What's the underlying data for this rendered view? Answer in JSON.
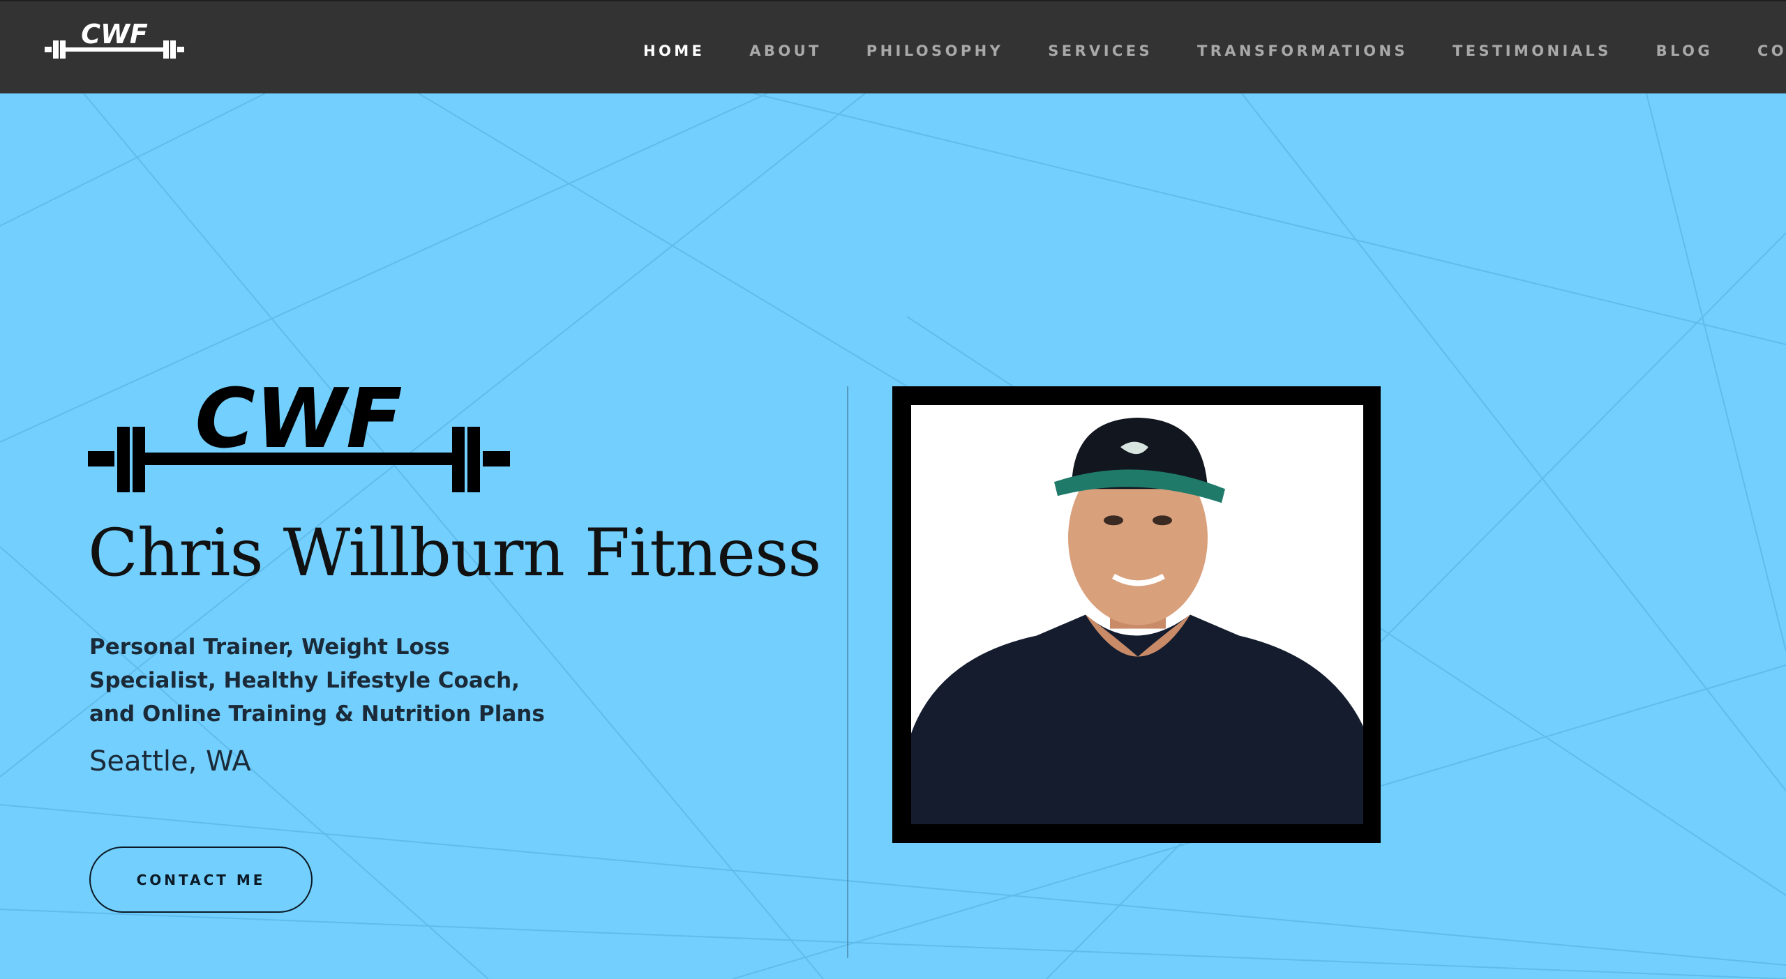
{
  "brand": {
    "logo_text": "CWF",
    "colors": {
      "nav_background": "#333333",
      "hero_background": "#73cffd",
      "nav_active": "#ffffff",
      "nav_inactive": "#a9a9a9"
    }
  },
  "nav": {
    "items": [
      {
        "label": "HOME",
        "active": true
      },
      {
        "label": "ABOUT",
        "active": false
      },
      {
        "label": "PHILOSOPHY",
        "active": false
      },
      {
        "label": "SERVICES",
        "active": false
      },
      {
        "label": "TRANSFORMATIONS",
        "active": false
      },
      {
        "label": "TESTIMONIALS",
        "active": false
      },
      {
        "label": "BLOG",
        "active": false
      },
      {
        "label": "CONTACT",
        "active": false
      }
    ]
  },
  "hero": {
    "logo_text": "CWF",
    "title": "Chris Willburn Fitness",
    "tagline": "Personal Trainer, Weight Loss Specialist, Healthy Lifestyle Coach, and Online Training & Nutrition Plans",
    "location": "Seattle, WA",
    "cta_label": "CONTACT ME",
    "portrait_icon": "portrait-photo-icon"
  }
}
